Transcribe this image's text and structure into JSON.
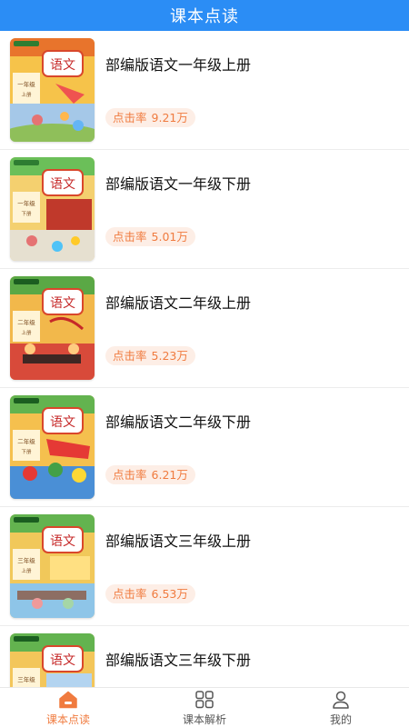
{
  "header": {
    "title": "课本点读"
  },
  "books": [
    {
      "title": "部编版语文一年级上册",
      "clicks_label": "点击率",
      "clicks": "9.21万",
      "grade": "一年级",
      "term": "上册"
    },
    {
      "title": "部编版语文一年级下册",
      "clicks_label": "点击率",
      "clicks": "5.01万",
      "grade": "一年级",
      "term": "下册"
    },
    {
      "title": "部编版语文二年级上册",
      "clicks_label": "点击率",
      "clicks": "5.23万",
      "grade": "二年级",
      "term": "上册"
    },
    {
      "title": "部编版语文二年级下册",
      "clicks_label": "点击率",
      "clicks": "6.21万",
      "grade": "二年级",
      "term": "下册"
    },
    {
      "title": "部编版语文三年级上册",
      "clicks_label": "点击率",
      "clicks": "6.53万",
      "grade": "三年级",
      "term": "上册"
    },
    {
      "title": "部编版语文三年级下册",
      "clicks_label": "",
      "clicks": "",
      "grade": "三年级",
      "term": ""
    }
  ],
  "cover": {
    "subject": "语文"
  },
  "tabs": [
    {
      "label": "课本点读",
      "icon": "home-icon",
      "active": true
    },
    {
      "label": "课本解析",
      "icon": "grid-icon",
      "active": false
    },
    {
      "label": "我的",
      "icon": "user-icon",
      "active": false
    }
  ],
  "colors": {
    "primary": "#2b8df5",
    "accent": "#f07b3f",
    "badge_bg": "#fdeee6"
  }
}
